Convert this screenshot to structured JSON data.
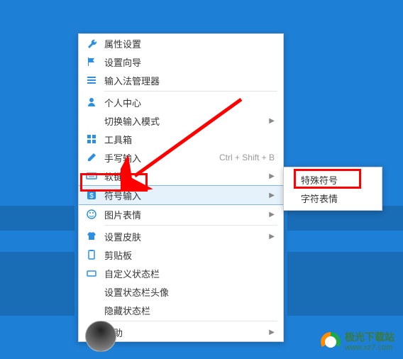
{
  "menu": {
    "items": [
      {
        "icon": "wrench-icon",
        "label": "属性设置"
      },
      {
        "icon": "flag-icon",
        "label": "设置向导"
      },
      {
        "icon": "list-icon",
        "label": "输入法管理器"
      },
      {
        "__divider": true
      },
      {
        "icon": "person-icon",
        "label": "个人中心"
      },
      {
        "icon": "",
        "label": "切换输入模式",
        "has_submenu": true
      },
      {
        "icon": "grid-icon",
        "label": "工具箱"
      },
      {
        "icon": "pen-icon",
        "label": "手写输入",
        "shortcut": "Ctrl + Shift + B"
      },
      {
        "icon": "keyboard-icon",
        "label": "软键盘",
        "has_submenu": true
      },
      {
        "icon": "symbol-icon",
        "label": "符号输入",
        "has_submenu": true,
        "active": true
      },
      {
        "icon": "smile-icon",
        "label": "图片表情",
        "has_submenu": true
      },
      {
        "__divider": true
      },
      {
        "icon": "shirt-icon",
        "label": "设置皮肤",
        "has_submenu": true
      },
      {
        "icon": "clipboard-icon",
        "label": "剪贴板"
      },
      {
        "icon": "tray-icon",
        "label": "自定义状态栏"
      },
      {
        "icon": "",
        "label": "设置状态栏头像"
      },
      {
        "icon": "",
        "label": "隐藏状态栏"
      },
      {
        "__divider": true
      },
      {
        "icon": "help-icon",
        "label": "帮助",
        "has_submenu": true
      }
    ]
  },
  "submenu": {
    "items": [
      {
        "label": "特殊符号"
      },
      {
        "label": "字符表情"
      }
    ]
  },
  "watermark": {
    "title": "极光下载站",
    "url": "www.xz7.com"
  },
  "colors": {
    "desktop": "#1e7fd6",
    "highlight": "#ff0000",
    "hover_bg": "#e6f2fb",
    "icon": "#2b90e3"
  }
}
